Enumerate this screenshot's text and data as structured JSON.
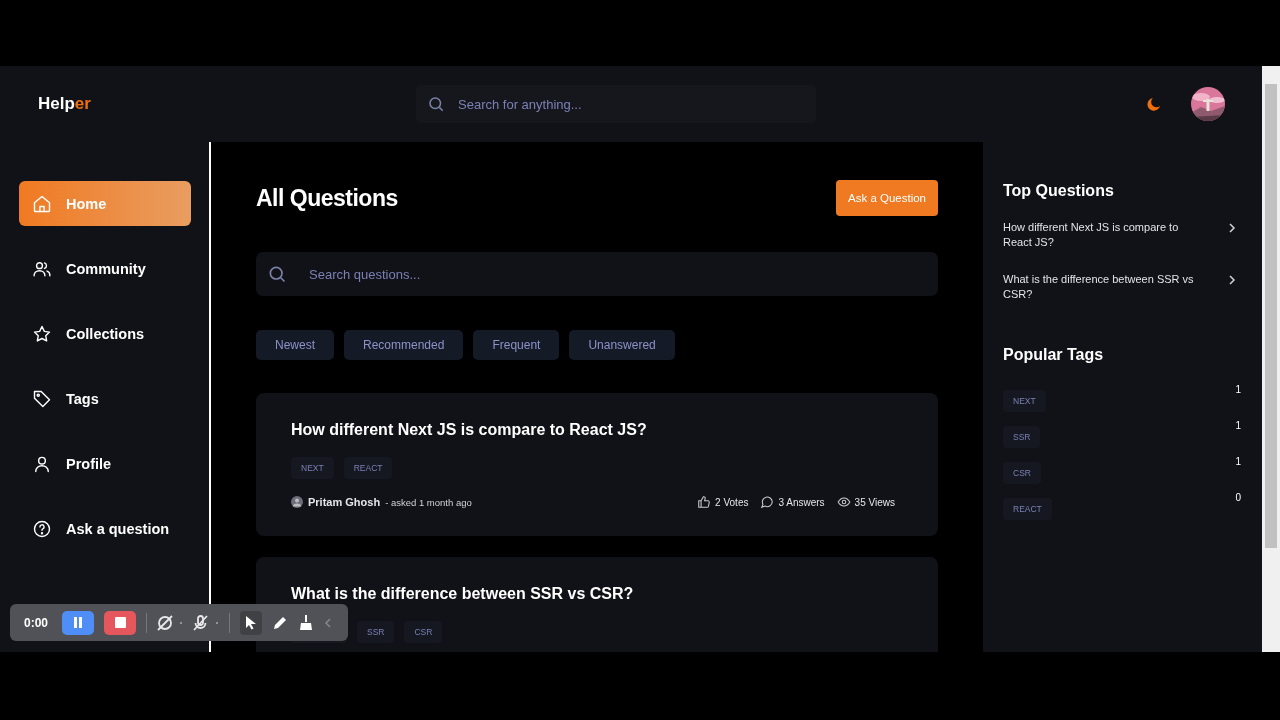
{
  "logo": {
    "main": "Help",
    "accent": "er"
  },
  "header": {
    "search": {
      "placeholder": "Search for anything..."
    }
  },
  "sidebar": {
    "items": [
      {
        "label": "Home",
        "selected": true
      },
      {
        "label": "Community",
        "selected": false
      },
      {
        "label": "Collections",
        "selected": false
      },
      {
        "label": "Tags",
        "selected": false
      },
      {
        "label": "Profile",
        "selected": false
      },
      {
        "label": "Ask a question",
        "selected": false
      }
    ]
  },
  "main": {
    "title": "All Questions",
    "ask_button": "Ask a Question",
    "search": {
      "placeholder": "Search questions..."
    },
    "filters": [
      {
        "label": "Newest",
        "selected": false
      },
      {
        "label": "Recommended",
        "selected": false
      },
      {
        "label": "Frequent",
        "selected": false
      },
      {
        "label": "Unanswered",
        "selected": false
      }
    ],
    "questions": [
      {
        "title": "How different Next JS is compare to React JS?",
        "tags": [
          "NEXT",
          "REACT"
        ],
        "covered": false,
        "author": "Pritam Ghosh",
        "asked": "- asked 1 month ago",
        "votes": "2 Votes",
        "answers": "3 Answers",
        "views": "35 Views"
      },
      {
        "title": "What is the difference between SSR vs CSR?",
        "tags": [
          "SSR",
          "CSR"
        ],
        "covered": true
      }
    ]
  },
  "right_panel": {
    "top_questions_title": "Top Questions",
    "top_questions": [
      "How different Next JS is compare to React JS?",
      "What is the difference between SSR vs CSR?"
    ],
    "popular_tags_title": "Popular Tags",
    "popular_tags": [
      {
        "label": "NEXT",
        "count": "1"
      },
      {
        "label": "SSR",
        "count": "1"
      },
      {
        "label": "CSR",
        "count": "1"
      },
      {
        "label": "REACT",
        "count": "0"
      }
    ]
  },
  "recorder": {
    "time": "0:00"
  }
}
